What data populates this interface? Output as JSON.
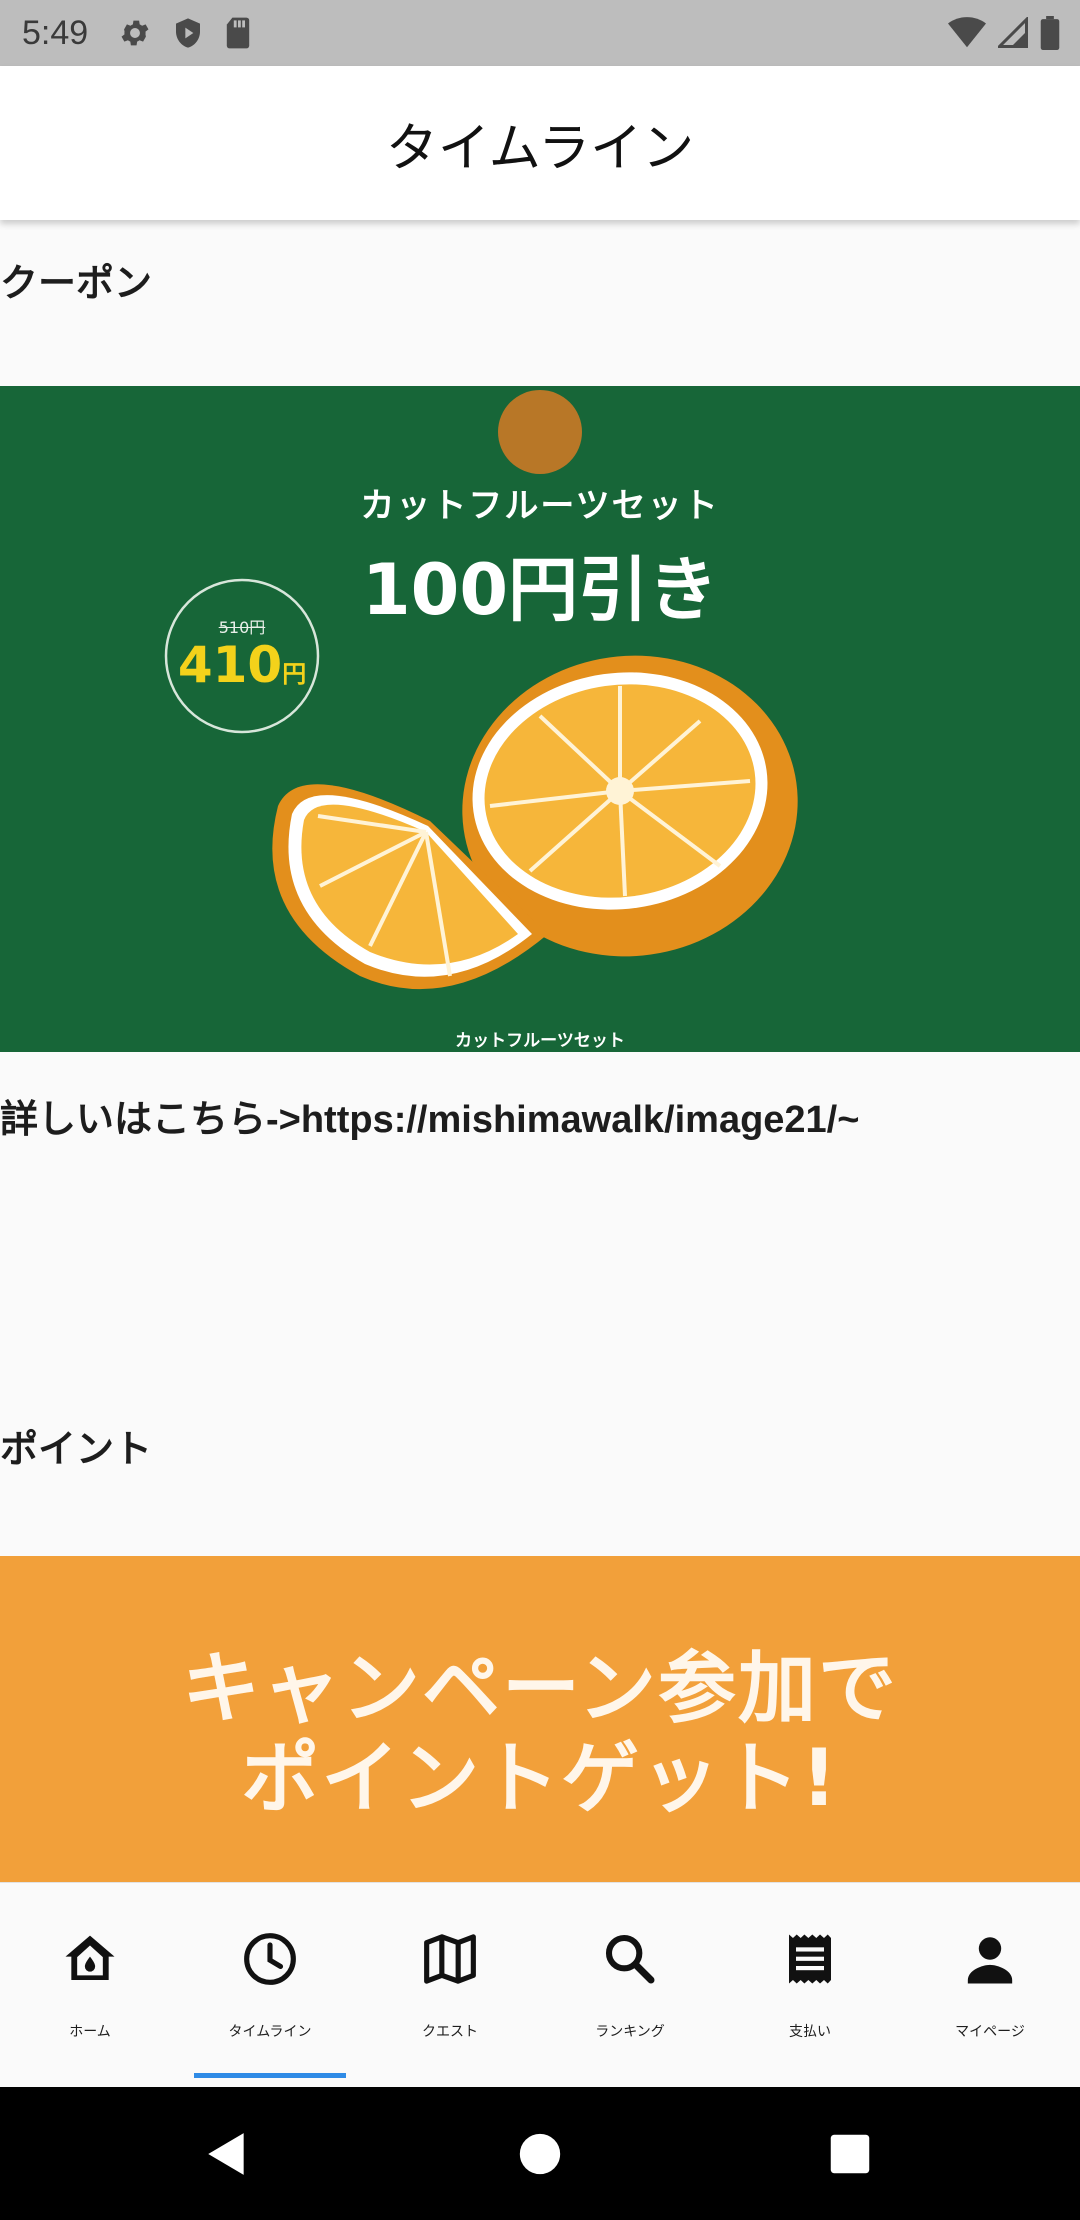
{
  "status_bar": {
    "time": "5:49"
  },
  "app_bar": {
    "title": "タイムライン"
  },
  "coupon_section": {
    "label": "クーポン",
    "banner": {
      "heading": "カットフルーツセット",
      "discount": "100円引き",
      "old_price": "510円",
      "new_price": "410",
      "new_price_unit": "円",
      "caption": "カットフルーツセット",
      "colors": {
        "background": "#176638",
        "price_yellow": "#f3d21b"
      }
    },
    "detail_text": "詳しいはこちら->https://mishimawalk/image21/~"
  },
  "points_section": {
    "label": "ポイント",
    "banner": {
      "line1": "キャンペーン参加で",
      "line2": "ポイントゲット!",
      "colors": {
        "background": "#f2a03a"
      }
    }
  },
  "bottom_nav": {
    "items": [
      {
        "label": "ホーム",
        "icon": "home-icon"
      },
      {
        "label": "タイムライン",
        "icon": "clock-icon",
        "active": true
      },
      {
        "label": "クエスト",
        "icon": "map-icon"
      },
      {
        "label": "ランキング",
        "icon": "search-icon"
      },
      {
        "label": "支払い",
        "icon": "receipt-icon"
      },
      {
        "label": "マイページ",
        "icon": "person-icon"
      }
    ],
    "active_color": "#2f8be6"
  }
}
